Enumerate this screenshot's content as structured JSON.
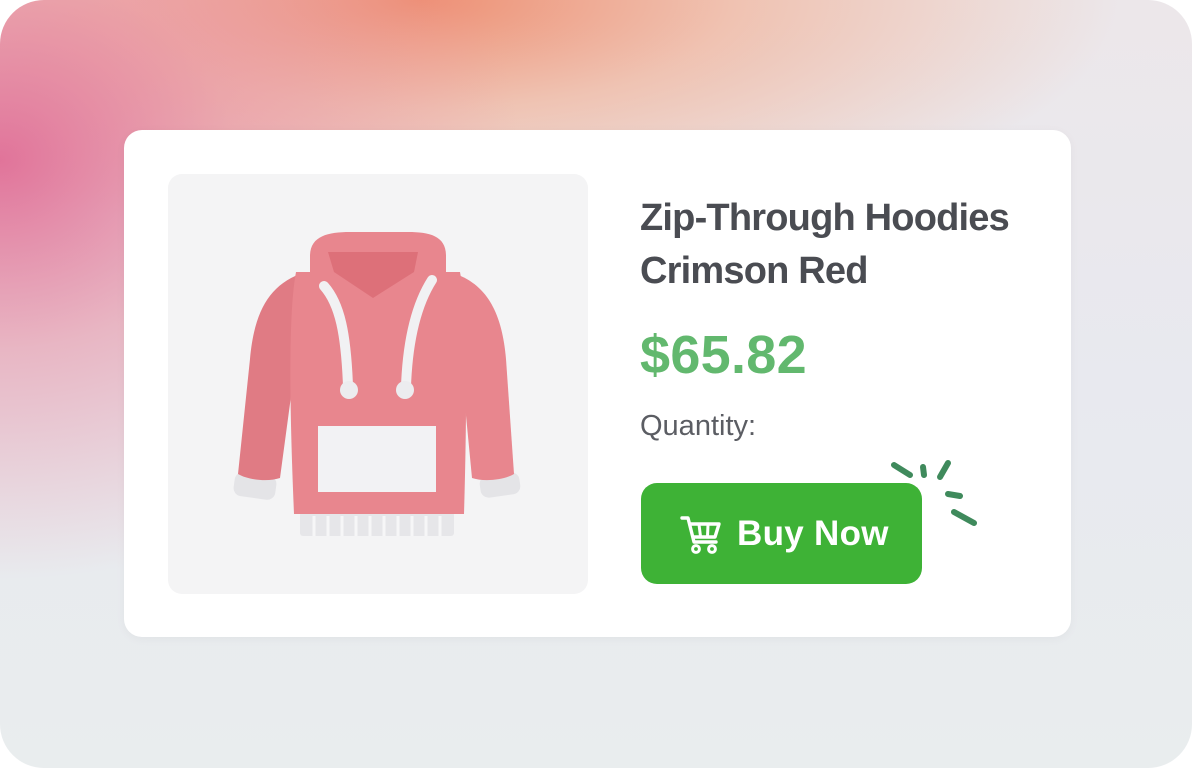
{
  "product": {
    "title_line1": "Zip-Through Hoodies",
    "title_line2": "Crimson Red",
    "price": "$65.82",
    "quantity_label": "Quantity:",
    "image_icon": "hoodie-icon"
  },
  "actions": {
    "buy_label": "Buy Now",
    "buy_icon": "shopping-cart-icon",
    "click_indicator_icon": "click-burst-icon"
  },
  "colors": {
    "price": "#62b86e",
    "buy_button": "#3eb236",
    "hoodie": "#e8868e",
    "title": "#4a4c52"
  }
}
